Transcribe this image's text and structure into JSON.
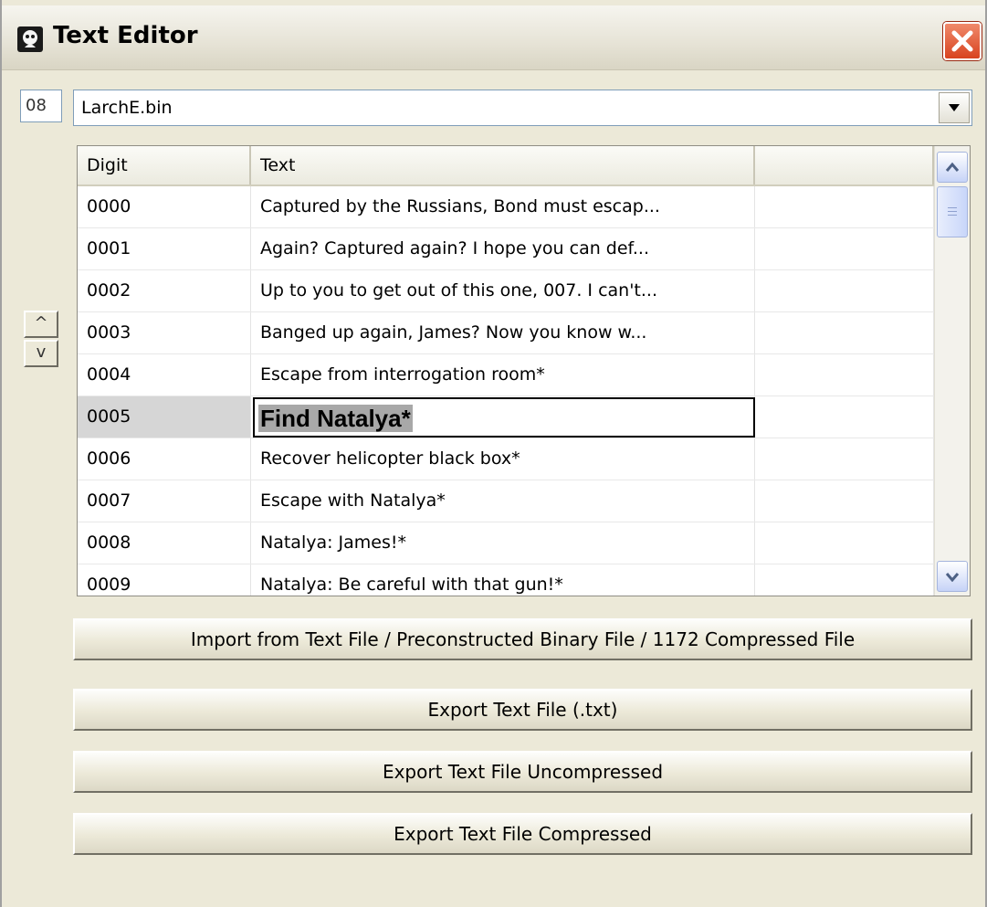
{
  "window": {
    "title": "Text Editor",
    "icon": "app-icon",
    "close_icon": "close-icon"
  },
  "file": {
    "slot": "08",
    "selected": "LarchE.bin"
  },
  "nudge": {
    "up": "^",
    "down": "v"
  },
  "table": {
    "columns": [
      "Digit",
      "Text",
      ""
    ],
    "rows": [
      {
        "digit": "0000",
        "text": "Captured by the Russians, Bond must escap..."
      },
      {
        "digit": "0001",
        "text": "Again? Captured again? I hope you can def..."
      },
      {
        "digit": "0002",
        "text": "Up to you to get out of this one, 007. I can't..."
      },
      {
        "digit": "0003",
        "text": "Banged up again, James? Now you know w..."
      },
      {
        "digit": "0004",
        "text": "Escape from interrogation room*"
      },
      {
        "digit": "0005",
        "text": "Find Natalya*",
        "editing": true
      },
      {
        "digit": "0006",
        "text": "Recover helicopter black box*"
      },
      {
        "digit": "0007",
        "text": "Escape with Natalya*"
      },
      {
        "digit": "0008",
        "text": "Natalya: James!*"
      },
      {
        "digit": "0009",
        "text": "Natalya: Be careful with that gun!*"
      }
    ]
  },
  "actions": {
    "import": "Import from Text File / Preconstructed Binary File / 1172 Compressed File",
    "export_txt": "Export Text File (.txt)",
    "export_uncompressed": "Export Text File Uncompressed",
    "export_compressed": "Export Text File Compressed"
  },
  "colors": {
    "window_bg": "#ece9d8",
    "close_button": "#d8431f",
    "selected_row": "#d6d6d6"
  }
}
